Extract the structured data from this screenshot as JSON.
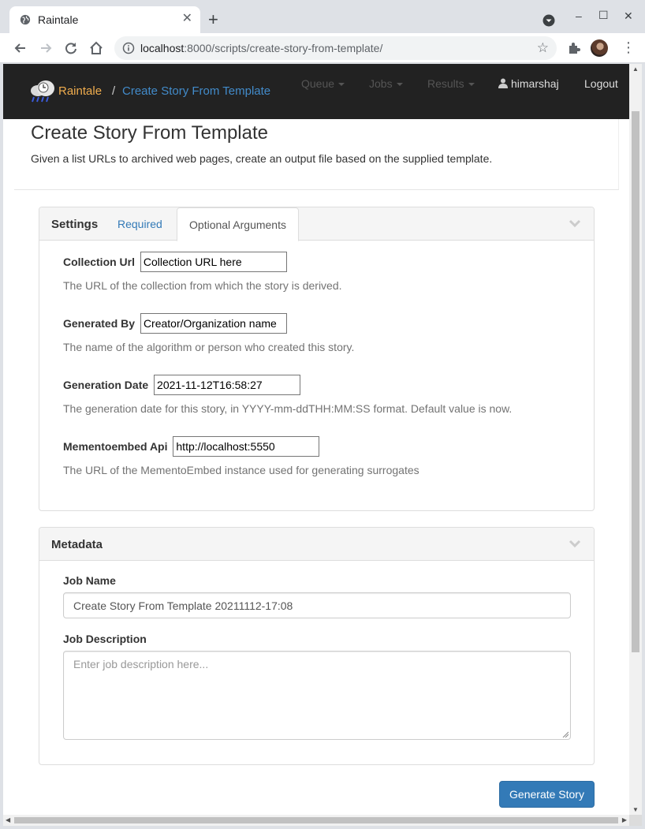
{
  "browser": {
    "tab_title": "Raintale",
    "new_tab": "+",
    "url_host": "localhost",
    "url_rest": ":8000/scripts/create-story-from-template/",
    "window_controls": [
      "–",
      "☐",
      "✕"
    ]
  },
  "navbar": {
    "brand": "Raintale",
    "separator": "/",
    "breadcrumb": "Create Story From Template",
    "menu": [
      "Queue",
      "Jobs",
      "Results"
    ],
    "user": "himarshaj",
    "logout": "Logout"
  },
  "header": {
    "title": "Create Story From Template",
    "description": "Given a list URLs to archived web pages, create an output file based on the supplied template."
  },
  "settings_panel": {
    "title": "Settings",
    "tabs": [
      "Required",
      "Optional Arguments"
    ],
    "active_tab": "Optional Arguments",
    "fields": [
      {
        "label": "Collection Url",
        "value": "Collection URL here",
        "help": "The URL of the collection from which the story is derived."
      },
      {
        "label": "Generated By",
        "value": "Creator/Organization name",
        "help": "The name of the algorithm or person who created this story."
      },
      {
        "label": "Generation Date",
        "value": "2021-11-12T16:58:27",
        "help": "The generation date for this story, in YYYY-mm-ddTHH:MM:SS format. Default value is now."
      },
      {
        "label": "Mementoembed Api",
        "value": "http://localhost:5550",
        "help": "The URL of the MementoEmbed instance used for generating surrogates"
      }
    ]
  },
  "metadata_panel": {
    "title": "Metadata",
    "job_name_label": "Job Name",
    "job_name_value": "Create Story From Template 20211112-17:08",
    "job_description_label": "Job Description",
    "job_description_placeholder": "Enter job description here..."
  },
  "submit_button": "Generate Story",
  "colors": {
    "navbar_bg": "#222222",
    "brand": "#f0ad4e",
    "link": "#337ab7",
    "primary_button": "#337ab7"
  }
}
